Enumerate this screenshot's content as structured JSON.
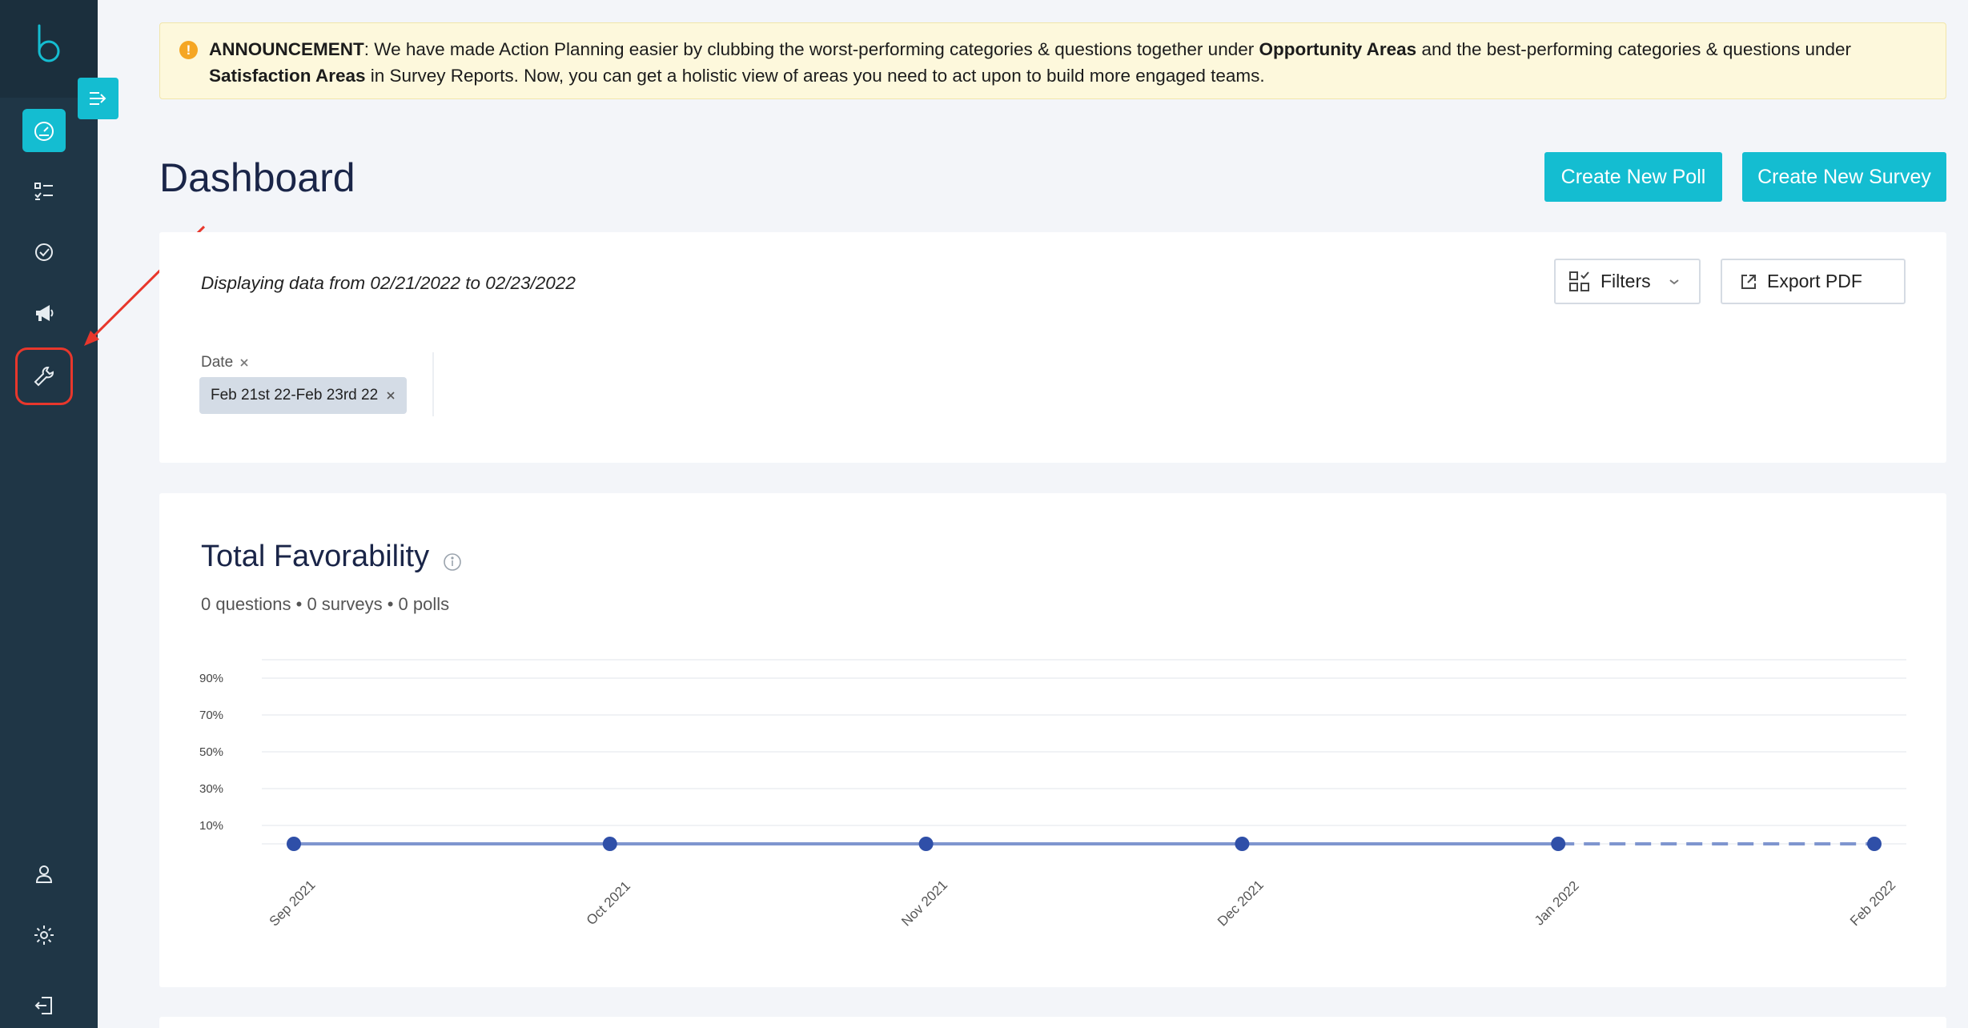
{
  "sidebar": {
    "items": [
      {
        "name": "dashboard",
        "icon": "speedometer-icon",
        "active": true
      },
      {
        "name": "checklist",
        "icon": "checklist-icon",
        "active": false
      },
      {
        "name": "check-circle",
        "icon": "check-circle-icon",
        "active": false
      },
      {
        "name": "announcements",
        "icon": "megaphone-icon",
        "active": false
      },
      {
        "name": "tools",
        "icon": "wrench-icon",
        "active": false,
        "highlighted": true
      },
      {
        "name": "profile",
        "icon": "user-icon",
        "active": false
      },
      {
        "name": "settings",
        "icon": "gear-icon",
        "active": false
      },
      {
        "name": "logout",
        "icon": "logout-icon",
        "active": false
      }
    ]
  },
  "announcement": {
    "prefix": "ANNOUNCEMENT",
    "part1": ": We have made Action Planning easier by clubbing the worst-performing categories & questions  together under ",
    "bold1": "Opportunity Areas",
    "part2": " and the best-performing  categories & questions under ",
    "bold2": "Satisfaction Areas",
    "part3": " in Survey Reports.  Now, you can get a holistic view of areas you need to act upon to build more engaged teams."
  },
  "header": {
    "title": "Dashboard",
    "create_poll_label": "Create New Poll",
    "create_survey_label": "Create New Survey"
  },
  "filters": {
    "range_text": "Displaying data from 02/21/2022 to 02/23/2022",
    "filters_label": "Filters",
    "export_label": "Export PDF",
    "date_label": "Date",
    "date_chip": "Feb 21st 22-Feb 23rd 22"
  },
  "favorability": {
    "title": "Total Favorability",
    "subtitle": "0 questions • 0 surveys • 0 polls"
  },
  "colors": {
    "accent": "#14bdd1",
    "sidebar": "#1f3646",
    "series": "#2f4fa8",
    "highlight": "#e8372c"
  },
  "chart_data": {
    "type": "line",
    "x": [
      "Sep 2021",
      "Oct 2021",
      "Nov 2021",
      "Dec 2021",
      "Jan 2022",
      "Feb 2022"
    ],
    "series": [
      {
        "values": [
          0,
          0,
          0,
          0,
          0,
          0
        ],
        "dashed_from_index": 4
      }
    ],
    "yticks": [
      "10%",
      "30%",
      "50%",
      "70%",
      "90%"
    ],
    "ytick_values": [
      10,
      30,
      50,
      70,
      90
    ],
    "ylim": [
      0,
      100
    ],
    "grid": true
  }
}
